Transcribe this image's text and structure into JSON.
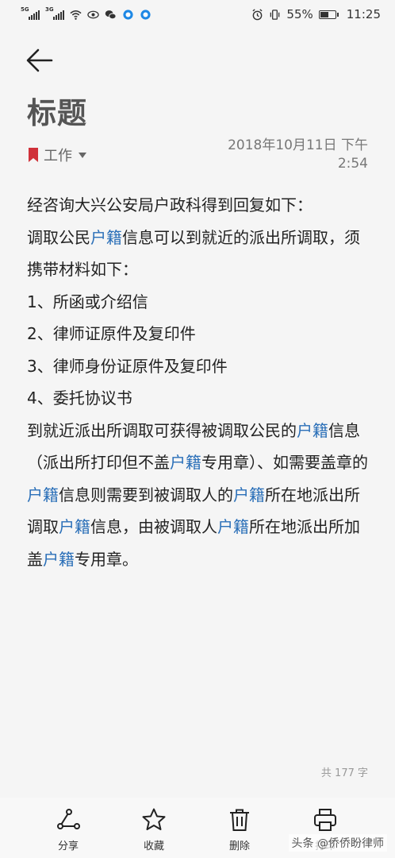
{
  "status_bar": {
    "sim1_type": "5G",
    "sim2_type": "3G",
    "battery": "55%",
    "battery_level": 0.55,
    "time": "11:25",
    "icons": [
      "wifi-icon",
      "eye-icon",
      "wechat-icon",
      "app-icon",
      "alarm-icon",
      "vibrate-icon",
      "battery-icon"
    ]
  },
  "header": {
    "title": "标题",
    "category": "工作",
    "category_color": "#d0313a",
    "date_line1": "2018年10月11日 下午",
    "date_line2": "2:54"
  },
  "body": {
    "lines": [
      [
        {
          "t": "经咨询大兴公安局户政科得到回复如下："
        }
      ],
      [
        {
          "t": "调取公民"
        },
        {
          "t": "户籍",
          "hl": true
        },
        {
          "t": "信息可以到就近的派出所调取，须携带材料如下："
        }
      ],
      [
        {
          "t": "1、所函或介绍信"
        }
      ],
      [
        {
          "t": "2、律师证原件及复印件"
        }
      ],
      [
        {
          "t": "3、律师身份证原件及复印件"
        }
      ],
      [
        {
          "t": "4、委托协议书"
        }
      ],
      [
        {
          "t": "到就近派出所调取可获得被调取公民的"
        },
        {
          "t": "户籍",
          "hl": true
        },
        {
          "t": "信息（派出所打印但不盖"
        },
        {
          "t": "户籍",
          "hl": true
        },
        {
          "t": "专用章）、如需要盖章的"
        },
        {
          "t": "户籍",
          "hl": true
        },
        {
          "t": "信息则需要到被调取人的"
        },
        {
          "t": "户籍",
          "hl": true
        },
        {
          "t": "所在地派出所调取"
        },
        {
          "t": "户籍",
          "hl": true
        },
        {
          "t": "信息，由被调取人"
        },
        {
          "t": "户籍",
          "hl": true
        },
        {
          "t": "所在地派出所加盖"
        },
        {
          "t": "户籍",
          "hl": true
        },
        {
          "t": "专用章。"
        }
      ]
    ],
    "highlight_color": "#2a6fb8"
  },
  "footer": {
    "word_count": "共 177 字"
  },
  "toolbar": {
    "share_label": "分享",
    "favorite_label": "收藏",
    "delete_label": "删除",
    "print_label": "打印"
  },
  "watermark": "头条 @侨侨盼律师"
}
